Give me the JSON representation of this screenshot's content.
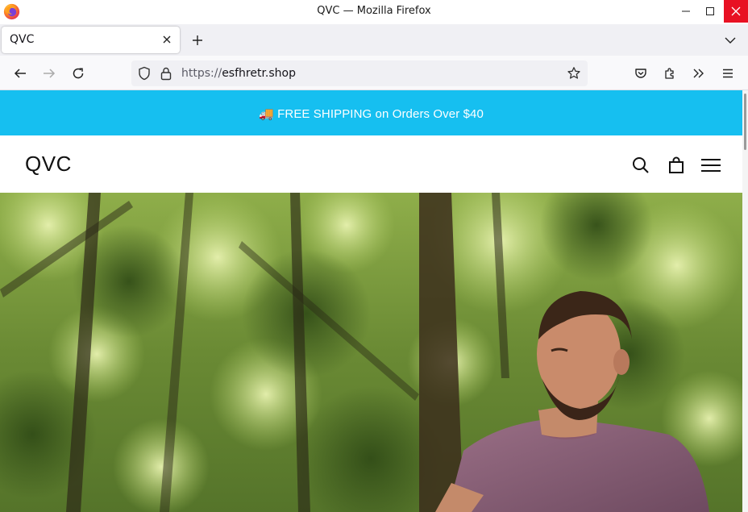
{
  "window": {
    "title": "QVC — Mozilla Firefox"
  },
  "tabs": [
    {
      "label": "QVC"
    }
  ],
  "urlbar": {
    "protocol": "https://",
    "host": "esfhretr.shop"
  },
  "site": {
    "banner_emoji": "🚚",
    "banner_text": "FREE SHIPPING on Orders Over $40",
    "logo": "QVC",
    "banner_color": "#16bff0"
  },
  "icons": {
    "header": [
      "search-icon",
      "shopping-bag-icon",
      "menu-icon"
    ],
    "browser": [
      "back-icon",
      "forward-icon",
      "reload-icon",
      "shield-icon",
      "lock-icon",
      "bookmark-star-icon",
      "pocket-icon",
      "extensions-icon",
      "overflow-icon",
      "app-menu-icon"
    ]
  }
}
